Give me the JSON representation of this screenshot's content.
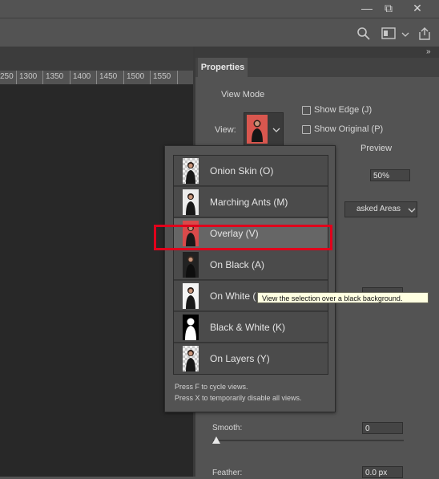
{
  "window": {
    "minimize": "—",
    "restore": "⧉",
    "close": "✕"
  },
  "ruler": {
    "ticks": [
      "250",
      "1300",
      "1350",
      "1400",
      "1450",
      "1500",
      "1550"
    ]
  },
  "panel": {
    "tab": "Properties",
    "view_mode": {
      "group_label": "View Mode",
      "view_label": "View:",
      "show_edge": "Show Edge (J)",
      "show_original": "Show Original (P)",
      "preview": "Preview",
      "opacity_value": "50%",
      "masked_areas": "asked Areas"
    },
    "smooth_label": "Smooth:",
    "smooth_value": "0",
    "feather_label": "Feather:",
    "feather_value": "0.0 px"
  },
  "view_menu": {
    "items": [
      {
        "label": "Onion Skin (O)",
        "thumb": "onion-skin"
      },
      {
        "label": "Marching Ants (M)",
        "thumb": "marching-ants"
      },
      {
        "label": "Overlay (V)",
        "thumb": "overlay"
      },
      {
        "label": "On Black (A)",
        "thumb": "on-black"
      },
      {
        "label": "On White (",
        "thumb": "on-white"
      },
      {
        "label": "Black & White (K)",
        "thumb": "black-white"
      },
      {
        "label": "On Layers (Y)",
        "thumb": "on-layers"
      }
    ],
    "selected_index": 2,
    "hint_line1": "Press F to cycle views.",
    "hint_line2": "Press X to temporarily disable all views."
  },
  "tooltip": "View the selection over a black background.",
  "colors": {
    "highlight": "#e0001b",
    "tooltip_bg": "#ffffe1",
    "overlay_red": "#d94a4a"
  }
}
